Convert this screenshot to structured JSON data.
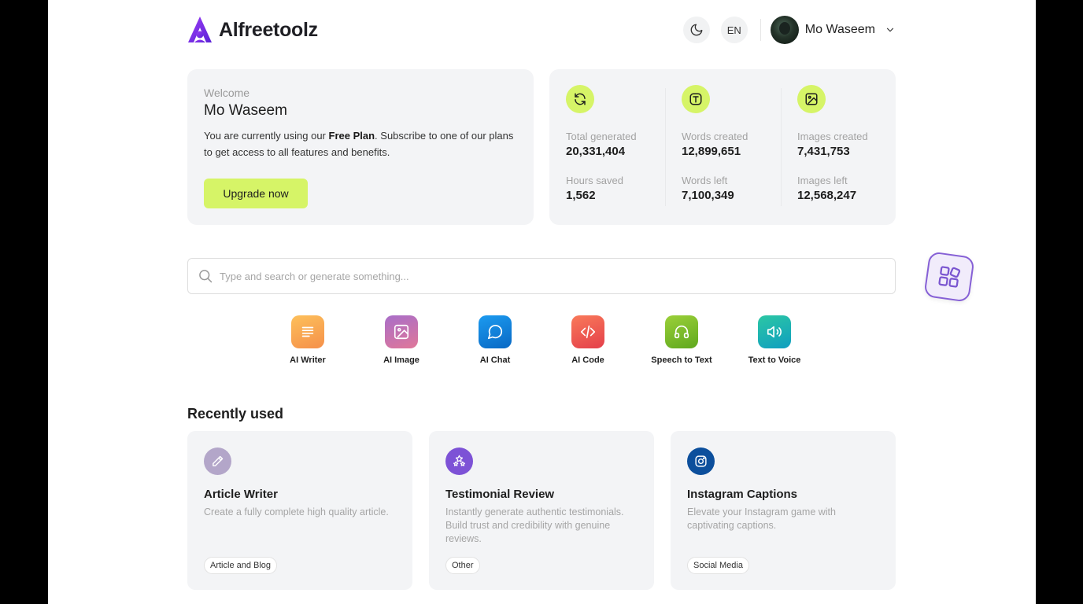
{
  "header": {
    "brand": "Alfreetoolz",
    "lang": "EN",
    "user_name": "Mo Waseem"
  },
  "welcome": {
    "label": "Welcome",
    "name": "Mo Waseem",
    "desc_prefix": "You are currently using our ",
    "plan": "Free Plan",
    "desc_suffix": ". Subscribe to one of our plans to get access to all features and benefits.",
    "upgrade_label": "Upgrade now"
  },
  "stats": {
    "total_generated_label": "Total generated",
    "total_generated": "20,331,404",
    "hours_saved_label": "Hours saved",
    "hours_saved": "1,562",
    "words_created_label": "Words created",
    "words_created": "12,899,651",
    "words_left_label": "Words left",
    "words_left": "7,100,349",
    "images_created_label": "Images created",
    "images_created": "7,431,753",
    "images_left_label": "Images left",
    "images_left": "12,568,247"
  },
  "search": {
    "placeholder": "Type and search or generate something..."
  },
  "tools": [
    {
      "label": "AI Writer",
      "icon": "lines-icon",
      "color": "#f9a84d"
    },
    {
      "label": "AI Image",
      "icon": "image-icon",
      "color": "#c26fae"
    },
    {
      "label": "AI Chat",
      "icon": "chat-bubble-icon",
      "color": "#1186e0"
    },
    {
      "label": "AI Code",
      "icon": "code-icon",
      "color": "#ee5b52"
    },
    {
      "label": "Speech to Text",
      "icon": "headphones-icon",
      "color": "#7cbf2a"
    },
    {
      "label": "Text to Voice",
      "icon": "speaker-icon",
      "color": "#1bb5a5"
    }
  ],
  "recent": {
    "title": "Recently used",
    "items": [
      {
        "title": "Article Writer",
        "desc": "Create a fully complete high quality article.",
        "tag": "Article and Blog",
        "icon": "pencil-icon",
        "color": "#b3a6c9"
      },
      {
        "title": "Testimonial Review",
        "desc": "Instantly generate authentic testimonials. Build trust and credibility with genuine reviews.",
        "tag": "Other",
        "icon": "stars-icon",
        "color": "#7d52d6"
      },
      {
        "title": "Instagram Captions",
        "desc": "Elevate your Instagram game with captivating captions.",
        "tag": "Social Media",
        "icon": "instagram-icon",
        "color": "#0c4f9c"
      }
    ]
  },
  "colors": {
    "accent": "#d6f467",
    "brand_purple": "#7b3ff2",
    "card_bg": "#f3f4f6"
  }
}
